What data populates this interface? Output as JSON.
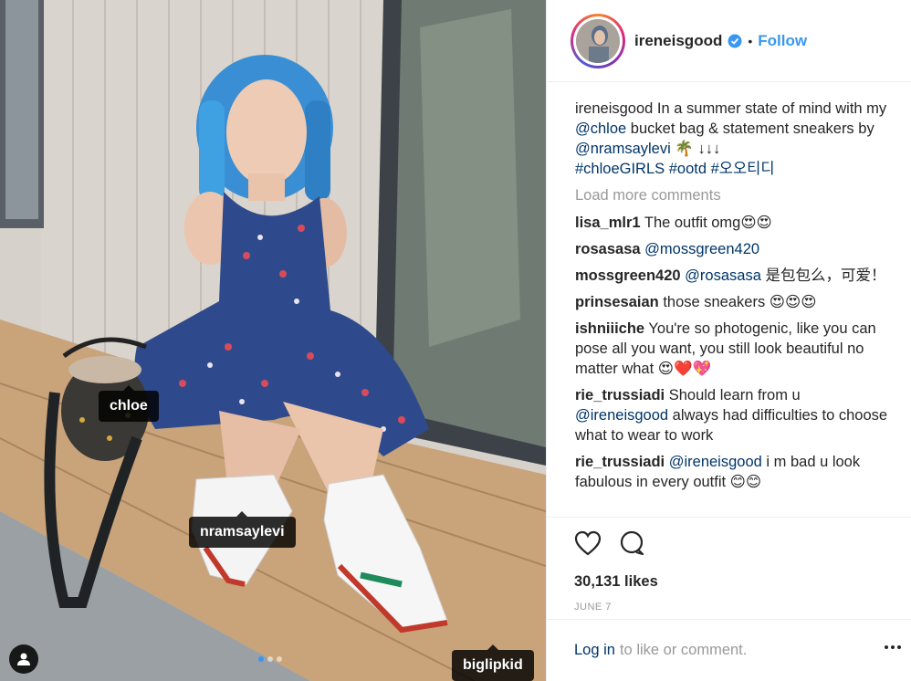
{
  "post": {
    "username": "ireneisgood",
    "separator": "•",
    "follow_label": "Follow",
    "caption": {
      "user": "ireneisgood",
      "text_1": "In a summer state of mind with my",
      "mention_1": "@chloe",
      "text_2": "bucket bag & statement sneakers by",
      "mention_2": "@nramsaylevi",
      "emoji": "🌴 ↓↓↓",
      "hashtag_1": "#chloeGIRLS",
      "hashtag_2": "#ootd",
      "hashtag_3": "#오오티디"
    },
    "load_more": "Load more comments",
    "comments": [
      {
        "user": "lisa_mlr1",
        "mention": "",
        "text": "The outfit omg😍😍"
      },
      {
        "user": "rosasasa",
        "mention": "@mossgreen420",
        "text": ""
      },
      {
        "user": "mossgreen420",
        "mention": "@rosasasa",
        "text": "是包包么，可爱！"
      },
      {
        "user": "prinsesaian",
        "mention": "",
        "text": "those sneakers 😍😍😍"
      },
      {
        "user": "ishniiiche",
        "mention": "",
        "text": "You're so photogenic, like you can pose all you want, you still look beautiful no matter what 😍❤️💖"
      },
      {
        "user": "rie_trussiadi",
        "mention": "",
        "text": "Should learn from u",
        "mention_after": "@ireneisgood",
        "text_after": "always had difficulties to choose what to wear to work"
      },
      {
        "user": "rie_trussiadi",
        "mention": "@ireneisgood",
        "text": "i m bad u look fabulous in every outfit 😊😊"
      }
    ],
    "likes": "30,131 likes",
    "date": "JUNE 7",
    "footer_login": "Log in",
    "footer_rest": "to like or comment."
  },
  "photo": {
    "tags": [
      "chloe",
      "nramsaylevi",
      "biglipkid"
    ],
    "carousel_count": 3,
    "carousel_active": 0
  },
  "icons": {
    "verified": "verified-badge-icon",
    "like": "heart-icon",
    "comment": "speech-bubble-icon",
    "more": "more-options-icon",
    "user_tags": "person-tag-icon"
  },
  "colors": {
    "link": "#3897f0",
    "mention": "#003569",
    "muted": "#999999",
    "text": "#262626"
  }
}
